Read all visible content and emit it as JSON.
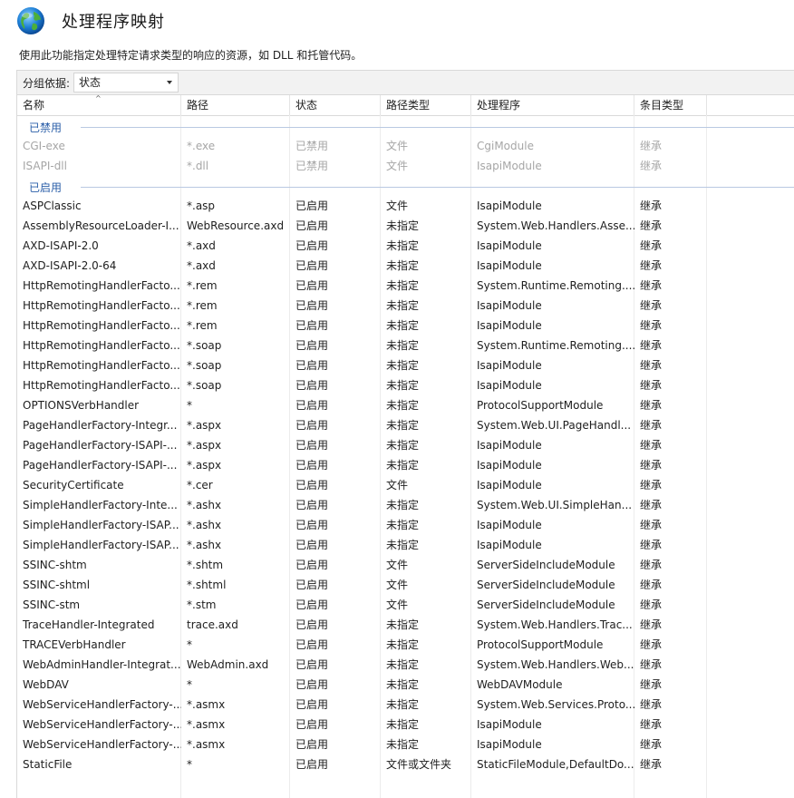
{
  "page": {
    "title": "处理程序映射",
    "description": "使用此功能指定处理特定请求类型的响应的资源，如 DLL 和托管代码。",
    "icon": "globe-icon"
  },
  "grouping": {
    "label": "分组依据:",
    "selected": "状态"
  },
  "columns": [
    "名称",
    "路径",
    "状态",
    "路径类型",
    "处理程序",
    "条目类型"
  ],
  "groups": [
    {
      "label": "已禁用",
      "disabled": true,
      "rows": [
        [
          "CGI-exe",
          "*.exe",
          "已禁用",
          "文件",
          "CgiModule",
          "继承"
        ],
        [
          "ISAPI-dll",
          "*.dll",
          "已禁用",
          "文件",
          "IsapiModule",
          "继承"
        ]
      ]
    },
    {
      "label": "已启用",
      "disabled": false,
      "rows": [
        [
          "ASPClassic",
          "*.asp",
          "已启用",
          "文件",
          "IsapiModule",
          "继承"
        ],
        [
          "AssemblyResourceLoader-I...",
          "WebResource.axd",
          "已启用",
          "未指定",
          "System.Web.Handlers.Asse...",
          "继承"
        ],
        [
          "AXD-ISAPI-2.0",
          "*.axd",
          "已启用",
          "未指定",
          "IsapiModule",
          "继承"
        ],
        [
          "AXD-ISAPI-2.0-64",
          "*.axd",
          "已启用",
          "未指定",
          "IsapiModule",
          "继承"
        ],
        [
          "HttpRemotingHandlerFacto...",
          "*.rem",
          "已启用",
          "未指定",
          "System.Runtime.Remoting....",
          "继承"
        ],
        [
          "HttpRemotingHandlerFacto...",
          "*.rem",
          "已启用",
          "未指定",
          "IsapiModule",
          "继承"
        ],
        [
          "HttpRemotingHandlerFacto...",
          "*.rem",
          "已启用",
          "未指定",
          "IsapiModule",
          "继承"
        ],
        [
          "HttpRemotingHandlerFacto...",
          "*.soap",
          "已启用",
          "未指定",
          "System.Runtime.Remoting....",
          "继承"
        ],
        [
          "HttpRemotingHandlerFacto...",
          "*.soap",
          "已启用",
          "未指定",
          "IsapiModule",
          "继承"
        ],
        [
          "HttpRemotingHandlerFacto...",
          "*.soap",
          "已启用",
          "未指定",
          "IsapiModule",
          "继承"
        ],
        [
          "OPTIONSVerbHandler",
          "*",
          "已启用",
          "未指定",
          "ProtocolSupportModule",
          "继承"
        ],
        [
          "PageHandlerFactory-Integr...",
          "*.aspx",
          "已启用",
          "未指定",
          "System.Web.UI.PageHandl...",
          "继承"
        ],
        [
          "PageHandlerFactory-ISAPI-...",
          "*.aspx",
          "已启用",
          "未指定",
          "IsapiModule",
          "继承"
        ],
        [
          "PageHandlerFactory-ISAPI-...",
          "*.aspx",
          "已启用",
          "未指定",
          "IsapiModule",
          "继承"
        ],
        [
          "SecurityCertificate",
          "*.cer",
          "已启用",
          "文件",
          "IsapiModule",
          "继承"
        ],
        [
          "SimpleHandlerFactory-Inte...",
          "*.ashx",
          "已启用",
          "未指定",
          "System.Web.UI.SimpleHan...",
          "继承"
        ],
        [
          "SimpleHandlerFactory-ISAP...",
          "*.ashx",
          "已启用",
          "未指定",
          "IsapiModule",
          "继承"
        ],
        [
          "SimpleHandlerFactory-ISAP...",
          "*.ashx",
          "已启用",
          "未指定",
          "IsapiModule",
          "继承"
        ],
        [
          "SSINC-shtm",
          "*.shtm",
          "已启用",
          "文件",
          "ServerSideIncludeModule",
          "继承"
        ],
        [
          "SSINC-shtml",
          "*.shtml",
          "已启用",
          "文件",
          "ServerSideIncludeModule",
          "继承"
        ],
        [
          "SSINC-stm",
          "*.stm",
          "已启用",
          "文件",
          "ServerSideIncludeModule",
          "继承"
        ],
        [
          "TraceHandler-Integrated",
          "trace.axd",
          "已启用",
          "未指定",
          "System.Web.Handlers.Trac...",
          "继承"
        ],
        [
          "TRACEVerbHandler",
          "*",
          "已启用",
          "未指定",
          "ProtocolSupportModule",
          "继承"
        ],
        [
          "WebAdminHandler-Integrat...",
          "WebAdmin.axd",
          "已启用",
          "未指定",
          "System.Web.Handlers.Web...",
          "继承"
        ],
        [
          "WebDAV",
          "*",
          "已启用",
          "未指定",
          "WebDAVModule",
          "继承"
        ],
        [
          "WebServiceHandlerFactory-...",
          "*.asmx",
          "已启用",
          "未指定",
          "System.Web.Services.Proto...",
          "继承"
        ],
        [
          "WebServiceHandlerFactory-...",
          "*.asmx",
          "已启用",
          "未指定",
          "IsapiModule",
          "继承"
        ],
        [
          "WebServiceHandlerFactory-...",
          "*.asmx",
          "已启用",
          "未指定",
          "IsapiModule",
          "继承"
        ],
        [
          "StaticFile",
          "*",
          "已启用",
          "文件或文件夹",
          "StaticFileModule,DefaultDo...",
          "继承"
        ]
      ]
    }
  ]
}
